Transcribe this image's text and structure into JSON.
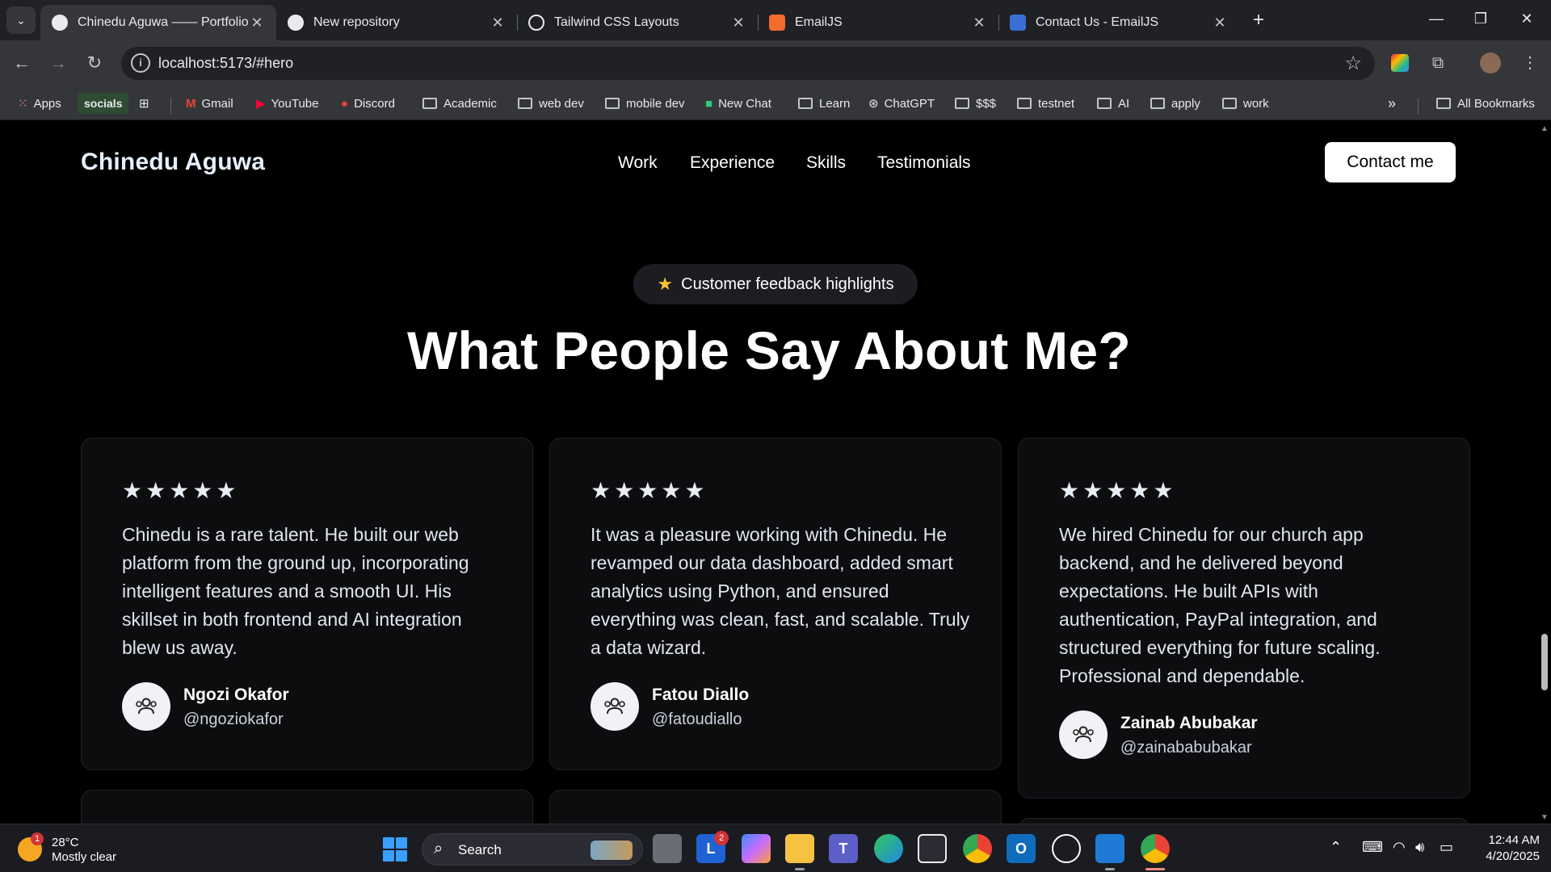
{
  "browser": {
    "tabs": [
      {
        "title": "Chinedu Aguwa —— Portfolio",
        "active": true
      },
      {
        "title": "New repository",
        "active": false
      },
      {
        "title": "Tailwind CSS Layouts",
        "active": false
      },
      {
        "title": "EmailJS",
        "active": false
      },
      {
        "title": "Contact Us - EmailJS",
        "active": false
      }
    ],
    "url": "localhost:5173/#hero",
    "bookmarks": {
      "apps": "Apps",
      "socials": "socials",
      "items": [
        "Gmail",
        "YouTube",
        "Discord",
        "Academic",
        "web dev",
        "mobile dev",
        "New Chat",
        "Learn",
        "ChatGPT",
        "$$$",
        "testnet",
        "AI",
        "apply",
        "work"
      ],
      "all": "All Bookmarks"
    }
  },
  "site": {
    "brand": "Chinedu Aguwa",
    "nav": [
      "Work",
      "Experience",
      "Skills",
      "Testimonials"
    ],
    "contact_button": "Contact me",
    "badge": "Customer feedback highlights",
    "heading": "What People Say About Me?",
    "testimonials": [
      {
        "stars": "★★★★★",
        "quote": "Chinedu is a rare talent. He built our web platform from the ground up, incorporating intelligent features and a smooth UI. His skillset in both frontend and AI integration blew us away.",
        "name": "Ngozi Okafor",
        "handle": "@ngoziokafor"
      },
      {
        "stars": "★★★★★",
        "quote": "It was a pleasure working with Chinedu. He revamped our data dashboard, added smart analytics using Python, and ensured everything was clean, fast, and scalable. Truly a data wizard.",
        "name": "Fatou Diallo",
        "handle": "@fatoudiallo"
      },
      {
        "stars": "★★★★★",
        "quote": "We hired Chinedu for our church app backend, and he delivered beyond expectations. He built APIs with authentication, PayPal integration, and structured everything for future scaling. Professional and dependable.",
        "name": "Zainab Abubakar",
        "handle": "@zainababubakar"
      }
    ]
  },
  "taskbar": {
    "weather_temp": "28°C",
    "weather_desc": "Mostly clear",
    "weather_badge": "1",
    "search": "Search",
    "mail_badge": "2",
    "time": "12:44 AM",
    "date": "4/20/2025"
  }
}
